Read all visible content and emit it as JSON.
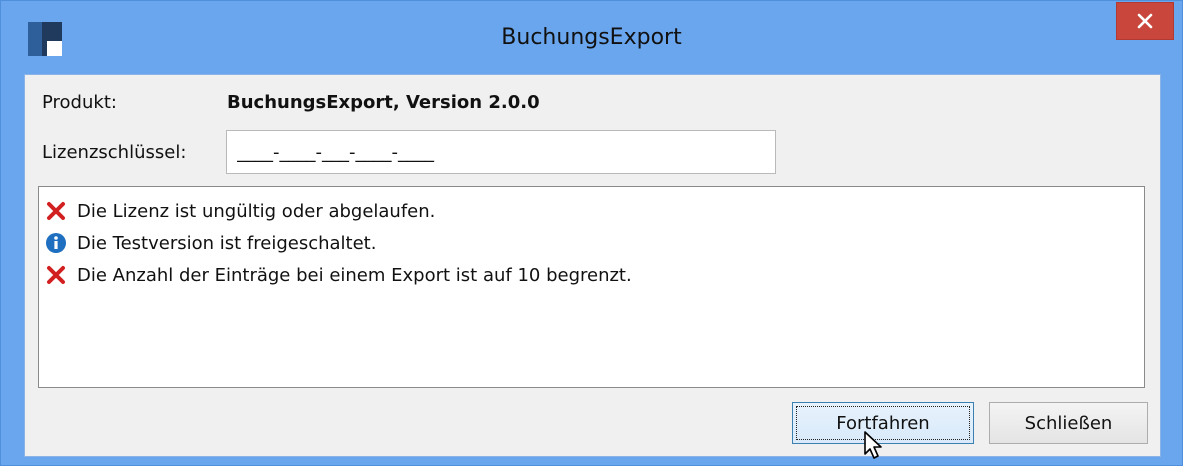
{
  "window": {
    "title": "BuchungsExport",
    "close_glyph": "✕",
    "accent_color": "#6aa6ee",
    "close_color": "#c9463d"
  },
  "form": {
    "product_label": "Produkt:",
    "product_value": "BuchungsExport, Version 2.0.0",
    "license_label": "Lizenzschlüssel:",
    "license_value": "____-____-___-____-____"
  },
  "messages": [
    {
      "icon": "error-x-icon",
      "text": "Die Lizenz ist ungültig oder abgelaufen."
    },
    {
      "icon": "info-icon",
      "text": "Die Testversion ist freigeschaltet."
    },
    {
      "icon": "error-x-icon",
      "text": "Die Anzahl der Einträge bei einem Export ist auf 10 begrenzt."
    }
  ],
  "buttons": {
    "continue_label": "Fortfahren",
    "close_label": "Schließen"
  }
}
